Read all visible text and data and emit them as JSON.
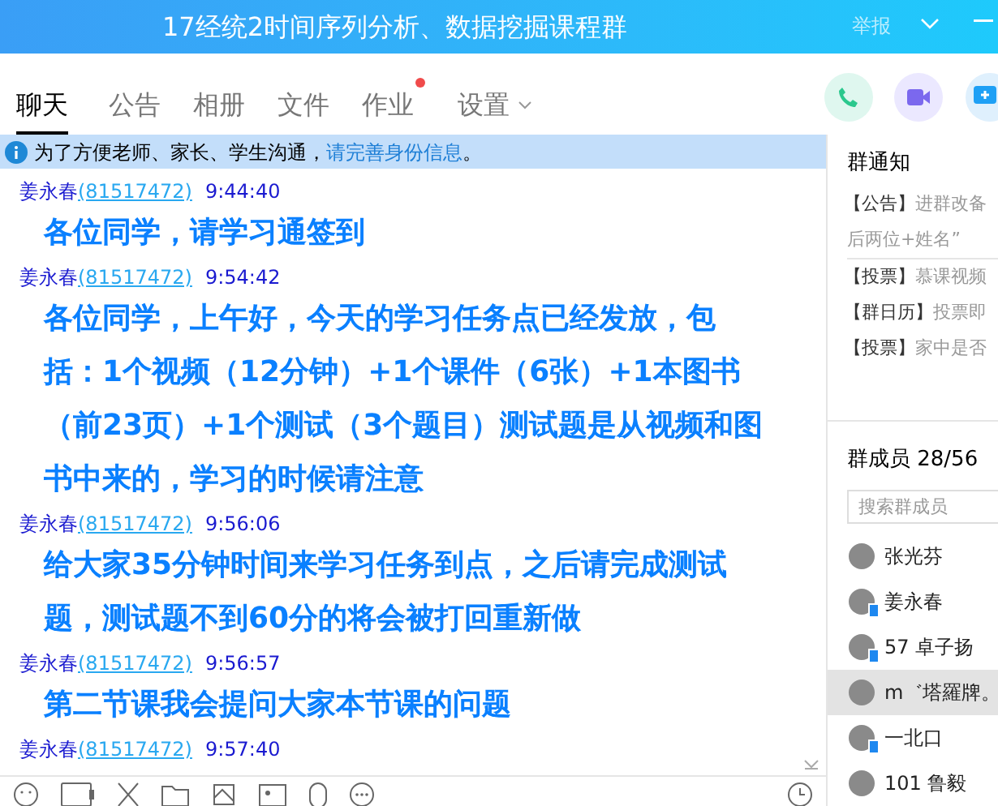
{
  "window": {
    "title": "17经统2时间序列分析、数据挖掘课程群",
    "report": "举报"
  },
  "tabs": [
    {
      "label": "聊天",
      "selected": true,
      "badge": false,
      "dropdown": false
    },
    {
      "label": "公告",
      "selected": false,
      "badge": false,
      "dropdown": false
    },
    {
      "label": "相册",
      "selected": false,
      "badge": false,
      "dropdown": false
    },
    {
      "label": "文件",
      "selected": false,
      "badge": false,
      "dropdown": false
    },
    {
      "label": "作业",
      "selected": false,
      "badge": true,
      "dropdown": false
    },
    {
      "label": "设置",
      "selected": false,
      "badge": false,
      "dropdown": true
    }
  ],
  "notice_bar": {
    "text": "为了方便老师、家长、学生沟通，",
    "link": "请完善身份信息",
    "end": "。"
  },
  "messages": [
    {
      "sender": "姜永春",
      "id": "(81517472)",
      "time": "9:44:40",
      "lines": [
        "各位同学，请学习通签到"
      ]
    },
    {
      "sender": "姜永春",
      "id": "(81517472)",
      "time": "9:54:42",
      "lines": [
        "各位同学，上午好，今天的学习任务点已经发放，包",
        "括：1个视频（12分钟）+1个课件（6张）+1本图书",
        "（前23页）+1个测试（3个题目）测试题是从视频和图",
        "书中来的，学习的时候请注意"
      ]
    },
    {
      "sender": "姜永春",
      "id": "(81517472)",
      "time": "9:56:06",
      "lines": [
        "给大家35分钟时间来学习任务到点，之后请完成测试",
        "题，测试题不到60分的将会被打回重新做"
      ]
    },
    {
      "sender": "姜永春",
      "id": "(81517472)",
      "time": "9:56:57",
      "lines": [
        "第二节课我会提问大家本节课的问题"
      ]
    },
    {
      "sender": "姜永春",
      "id": "(81517472)",
      "time": "9:57:40"
    }
  ],
  "group_notices": {
    "title": "群通知",
    "items": [
      {
        "tag": "【公告】",
        "text": "进群改备",
        "extra": "后两位+姓名”"
      },
      {
        "tag": "【投票】",
        "text": "慕课视频"
      },
      {
        "tag": "【群日历】",
        "text": "投票即"
      },
      {
        "tag": "【投票】",
        "text": "家中是否"
      }
    ]
  },
  "members": {
    "title": "群成员 28/56",
    "search_placeholder": "搜索群成员",
    "items": [
      {
        "name": "张光芬",
        "selected": false,
        "mobile": false
      },
      {
        "name": "姜永春",
        "selected": false,
        "mobile": true
      },
      {
        "name": "57 卓子扬",
        "selected": false,
        "mobile": true
      },
      {
        "name": "m゛塔羅牌。",
        "selected": true,
        "mobile": false
      },
      {
        "name": "一北口",
        "selected": false,
        "mobile": true
      },
      {
        "name": "101 鲁毅",
        "selected": false,
        "mobile": false
      }
    ]
  }
}
